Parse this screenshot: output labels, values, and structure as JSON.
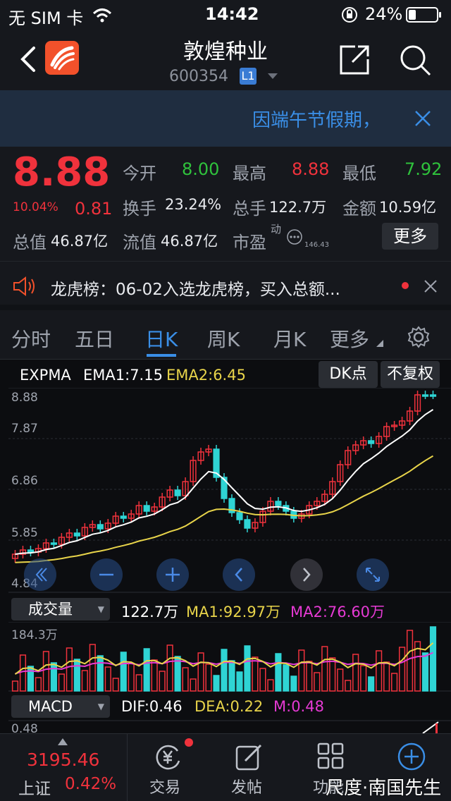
{
  "status": {
    "carrier": "无 SIM 卡",
    "time": "14:42",
    "battery": "24%"
  },
  "header": {
    "title": "敦煌种业",
    "code": "600354",
    "level": "L1"
  },
  "notice": {
    "text": "因端午节假期，"
  },
  "quote": {
    "price": "8.88",
    "change_pct": "10.04%",
    "change": "0.81",
    "open_label": "今开",
    "open": "8.00",
    "high_label": "最高",
    "high": "8.88",
    "low_label": "最低",
    "low": "7.92",
    "turnover_label": "换手",
    "turnover": "23.24%",
    "volume_label": "总手",
    "volume": "122.7万",
    "amount_label": "金额",
    "amount": "10.59亿",
    "mktcap_label": "总值",
    "mktcap": "46.87亿",
    "float_label": "流值",
    "float": "46.87亿",
    "pe_label": "市盈",
    "pe_sup": "动",
    "pe_sub": "146.43",
    "more_label": "更多"
  },
  "ticker": {
    "text": "龙虎榜：06-02入选龙虎榜，买入总额..."
  },
  "tabs": [
    {
      "label": "分时"
    },
    {
      "label": "五日"
    },
    {
      "label": "日K"
    },
    {
      "label": "周K"
    },
    {
      "label": "月K"
    },
    {
      "label": "更多"
    }
  ],
  "indicator": {
    "expma_label": "EXPMA",
    "ema1": "EMA1:7.15",
    "ema2": "EMA2:6.45",
    "dk_label": "DK点",
    "adjust_label": "不复权",
    "y_labels": [
      "8.88",
      "7.87",
      "6.86",
      "5.85",
      "4.84"
    ],
    "vol_label": "成交量",
    "vol_value": "122.7万",
    "vol_ma1": "MA1:92.97万",
    "vol_ma2": "MA2:76.60万",
    "vol_max": "184.3万",
    "macd_label": "MACD",
    "dif": "DIF:0.46",
    "dea": "DEA:0.22",
    "m": "M:0.48",
    "macd_top": "0.48"
  },
  "bottom": {
    "index_value": "3195.46",
    "index_name": "上证",
    "index_pct": "0.42%",
    "trade_label": "交易",
    "post_label": "发帖",
    "func_label": "功能",
    "watermark": "尺度·南国先生"
  },
  "colors": {
    "up": "#f0323c",
    "down": "#2fd4d4",
    "accent": "#3a8ee6",
    "ema1": "#ffffff",
    "ema2": "#e8d44a"
  }
}
